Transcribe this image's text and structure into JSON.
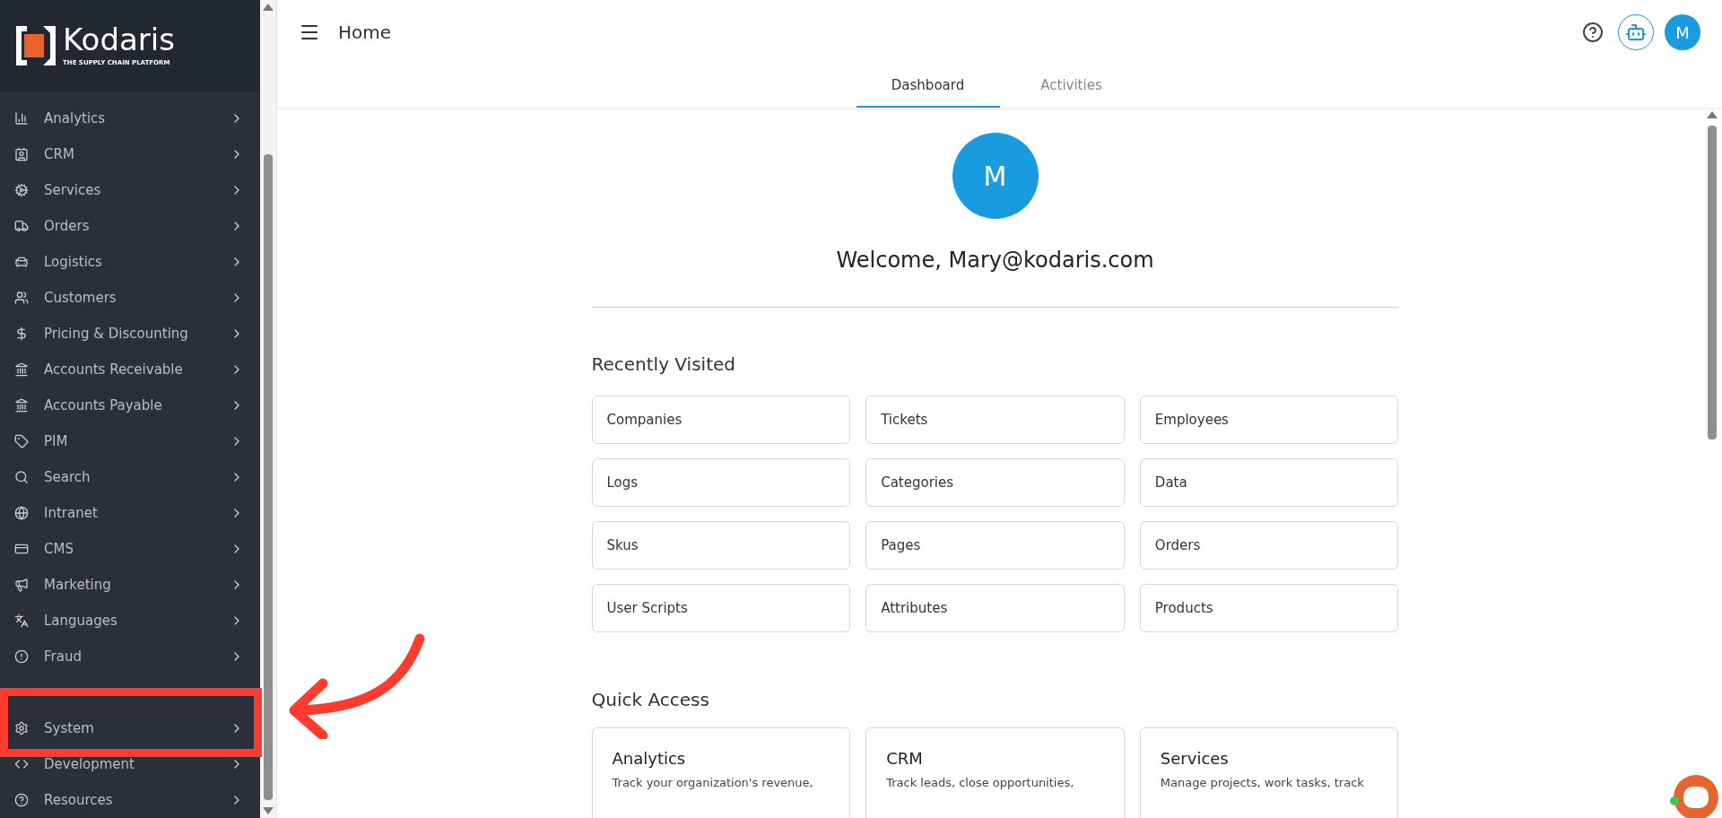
{
  "brand": {
    "name": "Kodaris",
    "tagline": "THE SUPPLY CHAIN PLATFORM"
  },
  "sidebar": {
    "items": [
      {
        "label": "Analytics",
        "kind": "analytics"
      },
      {
        "label": "CRM",
        "kind": "crm"
      },
      {
        "label": "Services",
        "kind": "services"
      },
      {
        "label": "Orders",
        "kind": "orders"
      },
      {
        "label": "Logistics",
        "kind": "logistics"
      },
      {
        "label": "Customers",
        "kind": "customers"
      },
      {
        "label": "Pricing & Discounting",
        "kind": "pricing"
      },
      {
        "label": "Accounts Receivable",
        "kind": "bank"
      },
      {
        "label": "Accounts Payable",
        "kind": "bank"
      },
      {
        "label": "PIM",
        "kind": "tag"
      },
      {
        "label": "Search",
        "kind": "search"
      },
      {
        "label": "Intranet",
        "kind": "globe"
      },
      {
        "label": "CMS",
        "kind": "cms"
      },
      {
        "label": "Marketing",
        "kind": "marketing"
      },
      {
        "label": "Languages",
        "kind": "languages"
      },
      {
        "label": "Fraud",
        "kind": "fraud"
      },
      {
        "kind": "hidden"
      },
      {
        "label": "System",
        "kind": "system"
      },
      {
        "label": "Development",
        "kind": "code"
      },
      {
        "label": "Resources",
        "kind": "help"
      }
    ]
  },
  "header": {
    "title": "Home",
    "avatar": "M"
  },
  "tabs": [
    {
      "label": "Dashboard",
      "selected": true
    },
    {
      "label": "Activities",
      "selected": false
    }
  ],
  "profile": {
    "initial": "M",
    "welcome": "Welcome, Mary@kodaris.com"
  },
  "recently_visited": {
    "title": "Recently Visited",
    "items": [
      "Companies",
      "Tickets",
      "Employees",
      "Logs",
      "Categories",
      "Data",
      "Skus",
      "Pages",
      "Orders",
      "User Scripts",
      "Attributes",
      "Products"
    ]
  },
  "quick_access": {
    "title": "Quick Access",
    "cards": [
      {
        "title": "Analytics",
        "description": "Track your organization's revenue,"
      },
      {
        "title": "CRM",
        "description": "Track leads, close opportunities,"
      },
      {
        "title": "Services",
        "description": "Manage projects, work tasks, track"
      }
    ]
  }
}
